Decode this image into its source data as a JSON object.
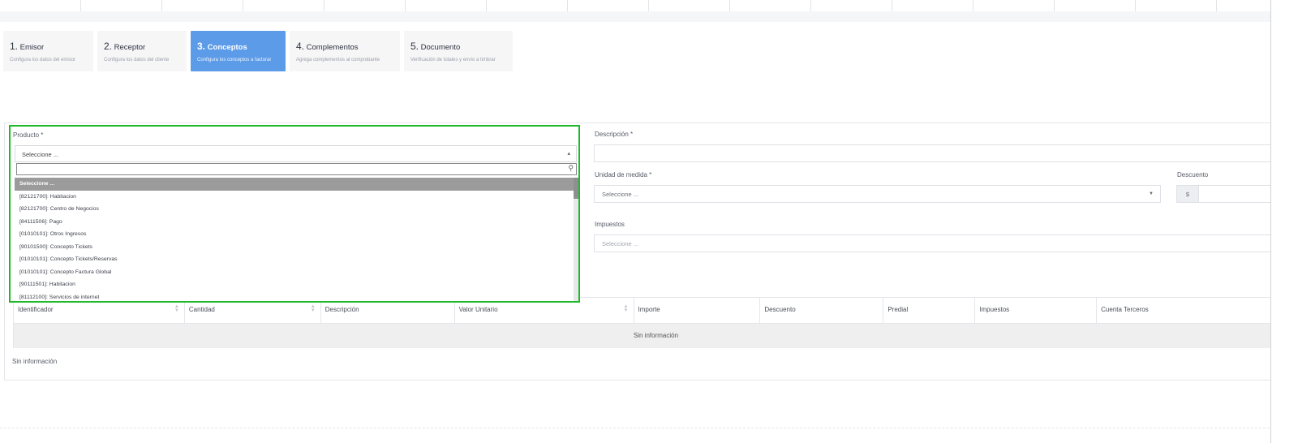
{
  "steps": [
    {
      "num": "1.",
      "title": "Emisor",
      "sub": "Configura los datos del emisor"
    },
    {
      "num": "2.",
      "title": "Receptor",
      "sub": "Configura los datos del cliente"
    },
    {
      "num": "3.",
      "title": "Conceptos",
      "sub": "Configura los conceptos a facturar"
    },
    {
      "num": "4.",
      "title": "Complementos",
      "sub": "Agrega complementos al comprobante"
    },
    {
      "num": "5.",
      "title": "Documento",
      "sub": "Verificación de totales y envío a timbrar"
    }
  ],
  "form": {
    "producto_label": "Producto *",
    "producto_value": "Seleccione ...",
    "descripcion_label": "Descripción *",
    "unidad_label": "Unidad de medida *",
    "unidad_value": "Seleccione ...",
    "descuento_label": "Descuento",
    "descuento_prefix": "$",
    "impuestos_label": "Impuestos",
    "impuestos_placeholder": "Seleccione ..."
  },
  "dropdown": {
    "options": [
      "Seleccione ...",
      "[82121700]: Habitacion",
      "[82121700]: Centro de Negocios",
      "[84111506]: Pago",
      "[01010101]: Otros Ingresos",
      "[90101500]: Concepto Tickets",
      "[01010101]: Concepto Tickets/Reservas",
      "[01010101]: Concepto Factura Global",
      "[90111501]: Habitacion",
      "[81112100]: Servicios de internet"
    ]
  },
  "table": {
    "headers": [
      "Identificador",
      "Cantidad",
      "Descripción",
      "Valor Unitario",
      "Importe",
      "Descuento",
      "Predial",
      "Impuestos",
      "Cuenta Terceros"
    ],
    "empty_text": "Sin información"
  },
  "below_table_text": "Sin información",
  "colors": {
    "active_step": "#5c9be8",
    "highlight_border": "#1fba2a"
  }
}
